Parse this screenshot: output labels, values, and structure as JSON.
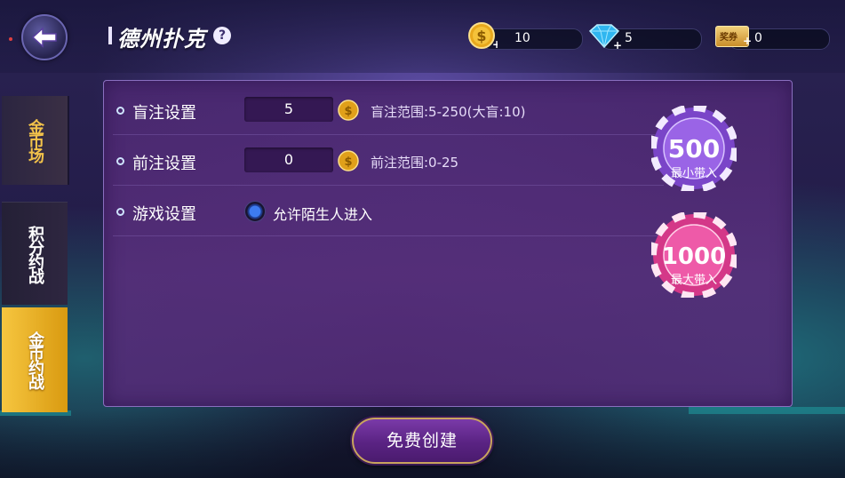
{
  "header": {
    "title": "德州扑克",
    "help_symbol": "?",
    "back_icon": "back-arrow-icon"
  },
  "resources": {
    "gold": {
      "icon": "gold-coin-icon",
      "value": "10"
    },
    "diamond": {
      "icon": "diamond-icon",
      "value": "5"
    },
    "ticket": {
      "icon": "ticket-icon",
      "label": "奖券",
      "value": "0"
    }
  },
  "sidebar": {
    "tabs": [
      {
        "label": "金币场",
        "state": "normal"
      },
      {
        "label": "积分约战",
        "state": "normal"
      },
      {
        "label": "金币约战",
        "state": "selected"
      }
    ]
  },
  "settings": {
    "blind": {
      "label": "盲注设置",
      "value": "5",
      "range": "盲注范围:5-250(大盲:10)"
    },
    "ante": {
      "label": "前注设置",
      "value": "0",
      "range": "前注范围:0-25"
    },
    "game": {
      "label": "游戏设置",
      "option": "允许陌生人进入",
      "checked": true
    }
  },
  "chips": {
    "min": {
      "amount": "500",
      "caption": "最小带入",
      "color": "#8e5ad8"
    },
    "max": {
      "amount": "1000",
      "caption": "最大带入",
      "color": "#e0489a"
    }
  },
  "actions": {
    "create_label": "免费创建"
  },
  "colors": {
    "accent_gold": "#f2c24a",
    "panel": "#4a2870"
  }
}
